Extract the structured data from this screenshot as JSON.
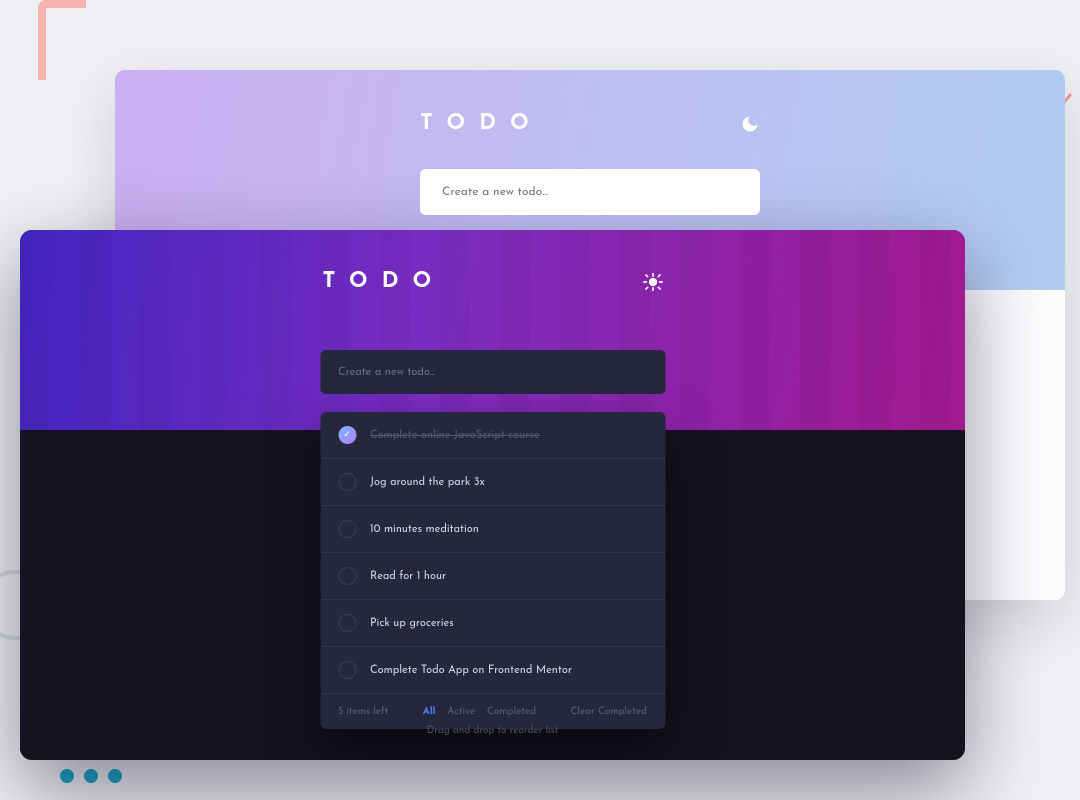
{
  "back": {
    "title": "TODO",
    "theme_icon": "moon-icon",
    "input_placeholder": "Create a new todo..."
  },
  "front": {
    "title": "TODO",
    "theme_icon": "sun-icon",
    "input_placeholder": "Create a new todo...",
    "items": [
      {
        "label": "Complete online JavaScript course",
        "completed": true
      },
      {
        "label": "Jog around the park 3x",
        "completed": false
      },
      {
        "label": "10 minutes meditation",
        "completed": false
      },
      {
        "label": "Read for 1 hour",
        "completed": false
      },
      {
        "label": "Pick up groceries",
        "completed": false
      },
      {
        "label": "Complete Todo App on Frontend Mentor",
        "completed": false
      }
    ],
    "footer": {
      "count_text": "5 items left",
      "filters": {
        "all": "All",
        "active": "Active",
        "completed": "Completed"
      },
      "active_filter": "all",
      "clear": "Clear Completed"
    },
    "hint": "Drag and drop to reorder list"
  },
  "colors": {
    "accent_blue": "#4d7fff",
    "dark_card": "#25273c",
    "dark_bg": "#14131f"
  }
}
